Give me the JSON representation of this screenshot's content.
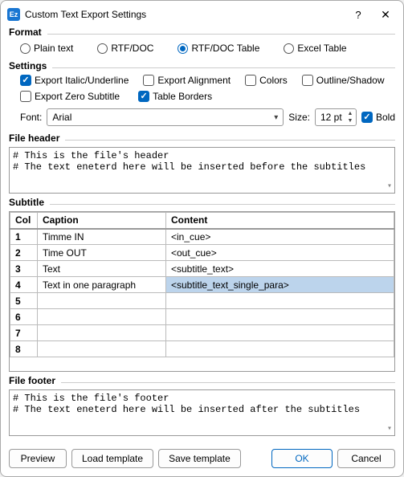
{
  "title": "Custom Text Export Settings",
  "format": {
    "label": "Format",
    "options": {
      "plain": "Plain text",
      "rtf": "RTF/DOC",
      "rtftable": "RTF/DOC Table",
      "excel": "Excel Table"
    },
    "selected": "rtftable"
  },
  "settings": {
    "label": "Settings",
    "checks": {
      "italic": {
        "label": "Export Italic/Underline",
        "checked": true
      },
      "align": {
        "label": "Export Alignment",
        "checked": false
      },
      "colors": {
        "label": "Colors",
        "checked": false
      },
      "outline": {
        "label": "Outline/Shadow",
        "checked": false
      },
      "zero": {
        "label": "Export Zero Subtitle",
        "checked": false
      },
      "borders": {
        "label": "Table Borders",
        "checked": true
      }
    },
    "fontLabel": "Font:",
    "fontValue": "Arial",
    "sizeLabel": "Size:",
    "sizeValue": "12 pt",
    "bold": {
      "label": "Bold",
      "checked": true
    }
  },
  "header": {
    "label": "File header",
    "text": "# This is the file's header\n# The text eneterd here will be inserted before the subtitles"
  },
  "subtitle": {
    "label": "Subtitle",
    "cols": {
      "col": "Col",
      "caption": "Caption",
      "content": "Content"
    },
    "rows": [
      {
        "n": "1",
        "caption": "Timme IN",
        "content": "<in_cue>"
      },
      {
        "n": "2",
        "caption": "Time OUT",
        "content": "<out_cue>"
      },
      {
        "n": "3",
        "caption": "Text",
        "content": "<subtitle_text>"
      },
      {
        "n": "4",
        "caption": "Text in one paragraph",
        "content": "<subtitle_text_single_para>"
      },
      {
        "n": "5",
        "caption": "",
        "content": ""
      },
      {
        "n": "6",
        "caption": "",
        "content": ""
      },
      {
        "n": "7",
        "caption": "",
        "content": ""
      },
      {
        "n": "8",
        "caption": "",
        "content": ""
      }
    ],
    "selected_cell": {
      "row": 3,
      "col": "content"
    }
  },
  "footer": {
    "label": "File footer",
    "text": "# This is the file's footer\n# The text eneterd here will be inserted after the subtitles"
  },
  "buttons": {
    "preview": "Preview",
    "load": "Load template",
    "save": "Save template",
    "ok": "OK",
    "cancel": "Cancel"
  }
}
